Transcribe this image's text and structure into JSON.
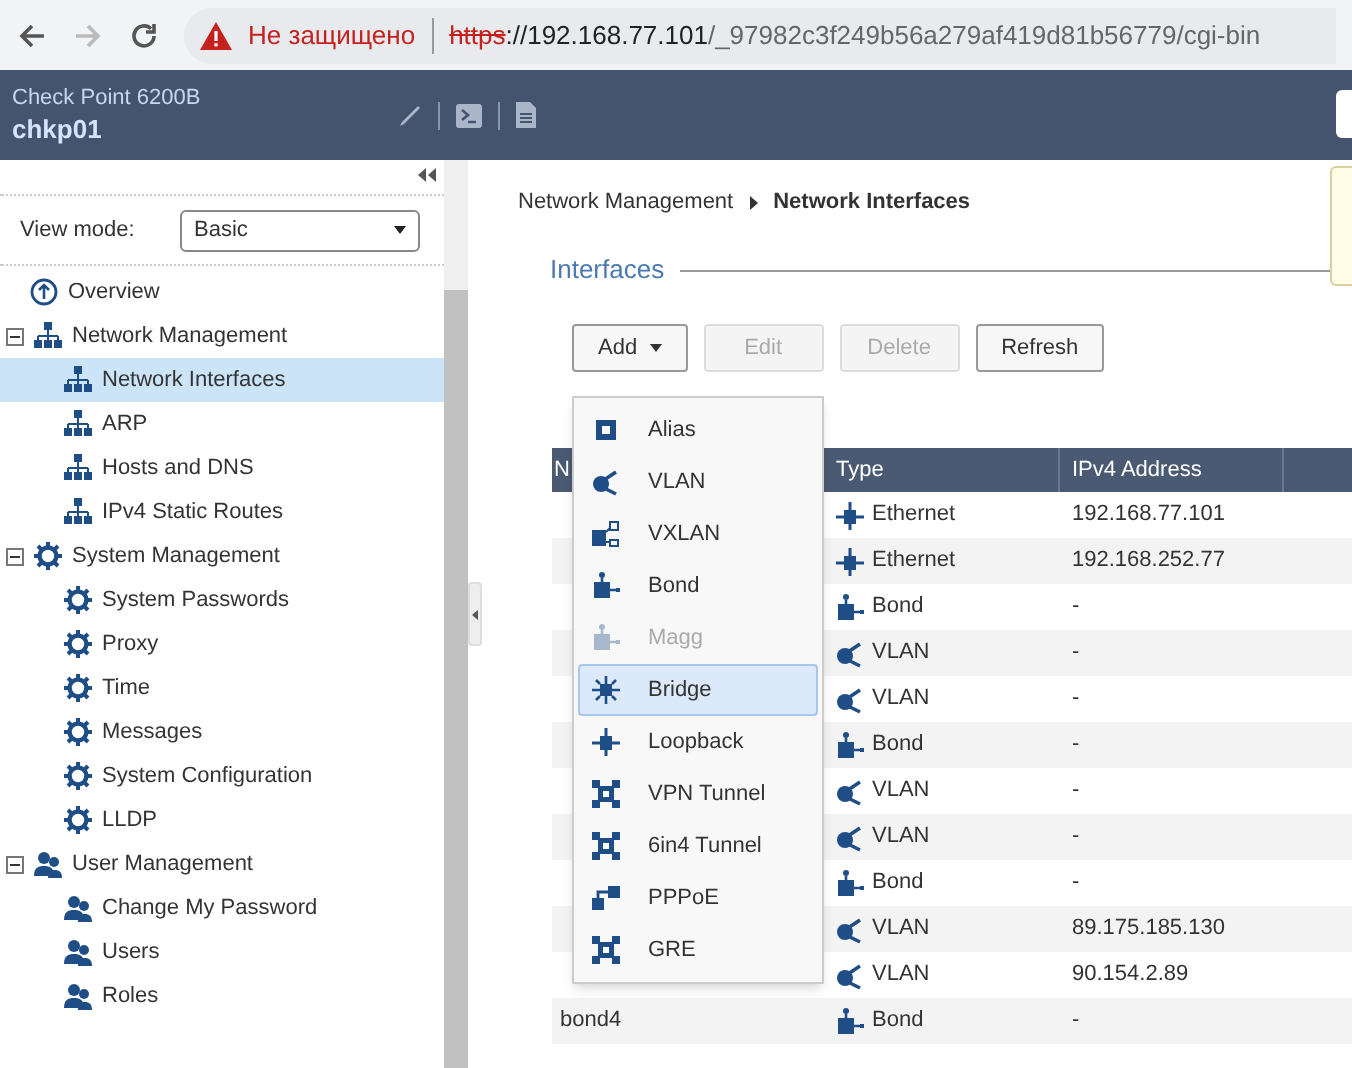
{
  "browser": {
    "security_warning": "Не защищено",
    "url_scheme": "https",
    "url_host": "://192.168.77.101",
    "url_path": "/_97982c3f249b56a279af419d81b56779/cgi-bin"
  },
  "header": {
    "product": "Check Point 6200B",
    "hostname": "chkp01"
  },
  "sidebar": {
    "view_mode_label": "View mode:",
    "view_mode": "Basic",
    "items": [
      {
        "label": "Overview",
        "kind": "overview",
        "selected": false
      },
      {
        "label": "Network Management",
        "kind": "network",
        "expanded": true,
        "selected": false,
        "children": [
          {
            "label": "Network Interfaces",
            "kind": "network",
            "selected": true
          },
          {
            "label": "ARP",
            "kind": "network",
            "selected": false
          },
          {
            "label": "Hosts and DNS",
            "kind": "network",
            "selected": false
          },
          {
            "label": "IPv4 Static Routes",
            "kind": "network",
            "selected": false
          }
        ]
      },
      {
        "label": "System Management",
        "kind": "gear",
        "expanded": true,
        "selected": false,
        "children": [
          {
            "label": "System Passwords",
            "kind": "gear",
            "selected": false
          },
          {
            "label": "Proxy",
            "kind": "gear",
            "selected": false
          },
          {
            "label": "Time",
            "kind": "gear",
            "selected": false
          },
          {
            "label": "Messages",
            "kind": "gear",
            "selected": false
          },
          {
            "label": "System Configuration",
            "kind": "gear",
            "selected": false
          },
          {
            "label": "LLDP",
            "kind": "gear",
            "selected": false
          }
        ]
      },
      {
        "label": "User Management",
        "kind": "users",
        "expanded": true,
        "selected": false,
        "children": [
          {
            "label": "Change My Password",
            "kind": "users",
            "selected": false
          },
          {
            "label": "Users",
            "kind": "users",
            "selected": false
          },
          {
            "label": "Roles",
            "kind": "users",
            "selected": false
          }
        ]
      }
    ]
  },
  "breadcrumb": [
    "Network Management",
    "Network Interfaces"
  ],
  "section_title": "Interfaces",
  "toolbar": [
    {
      "label": "Add",
      "disabled": false,
      "dropdown": true
    },
    {
      "label": "Edit",
      "disabled": true,
      "dropdown": false
    },
    {
      "label": "Delete",
      "disabled": true,
      "dropdown": false
    },
    {
      "label": "Refresh",
      "disabled": false,
      "dropdown": false
    }
  ],
  "add_menu": [
    {
      "label": "Alias",
      "kind": "alias",
      "disabled": false,
      "selected": false
    },
    {
      "label": "VLAN",
      "kind": "vlan",
      "disabled": false,
      "selected": false
    },
    {
      "label": "VXLAN",
      "kind": "vxlan",
      "disabled": false,
      "selected": false
    },
    {
      "label": "Bond",
      "kind": "bond",
      "disabled": false,
      "selected": false
    },
    {
      "label": "Magg",
      "kind": "bond",
      "disabled": true,
      "selected": false
    },
    {
      "label": "Bridge",
      "kind": "bridge",
      "disabled": false,
      "selected": true
    },
    {
      "label": "Loopback",
      "kind": "ethernet",
      "disabled": false,
      "selected": false
    },
    {
      "label": "VPN Tunnel",
      "kind": "tunnel",
      "disabled": false,
      "selected": false
    },
    {
      "label": "6in4 Tunnel",
      "kind": "tunnel",
      "disabled": false,
      "selected": false
    },
    {
      "label": "PPPoE",
      "kind": "pppoe",
      "disabled": false,
      "selected": false
    },
    {
      "label": "GRE",
      "kind": "tunnel",
      "disabled": false,
      "selected": false
    }
  ],
  "table": {
    "columns": [
      "N",
      "Type",
      "IPv4 Address"
    ],
    "rows": [
      {
        "type": "Ethernet",
        "kind": "ethernet",
        "ipv4": "192.168.77.101"
      },
      {
        "type": "Ethernet",
        "kind": "ethernet",
        "ipv4": "192.168.252.77"
      },
      {
        "type": "Bond",
        "kind": "bond",
        "ipv4": "-"
      },
      {
        "type": "VLAN",
        "kind": "vlan",
        "ipv4": "-"
      },
      {
        "type": "VLAN",
        "kind": "vlan",
        "ipv4": "-"
      },
      {
        "type": "Bond",
        "kind": "bond",
        "ipv4": "-"
      },
      {
        "type": "VLAN",
        "kind": "vlan",
        "ipv4": "-"
      },
      {
        "type": "VLAN",
        "kind": "vlan",
        "ipv4": "-"
      },
      {
        "type": "Bond",
        "kind": "bond",
        "ipv4": "-"
      },
      {
        "type": "VLAN",
        "kind": "vlan",
        "ipv4": "89.175.185.130"
      },
      {
        "type": "VLAN",
        "kind": "vlan",
        "ipv4": "90.154.2.89"
      },
      {
        "name": "bond4",
        "type": "Bond",
        "kind": "bond",
        "ipv4": "-"
      }
    ]
  }
}
